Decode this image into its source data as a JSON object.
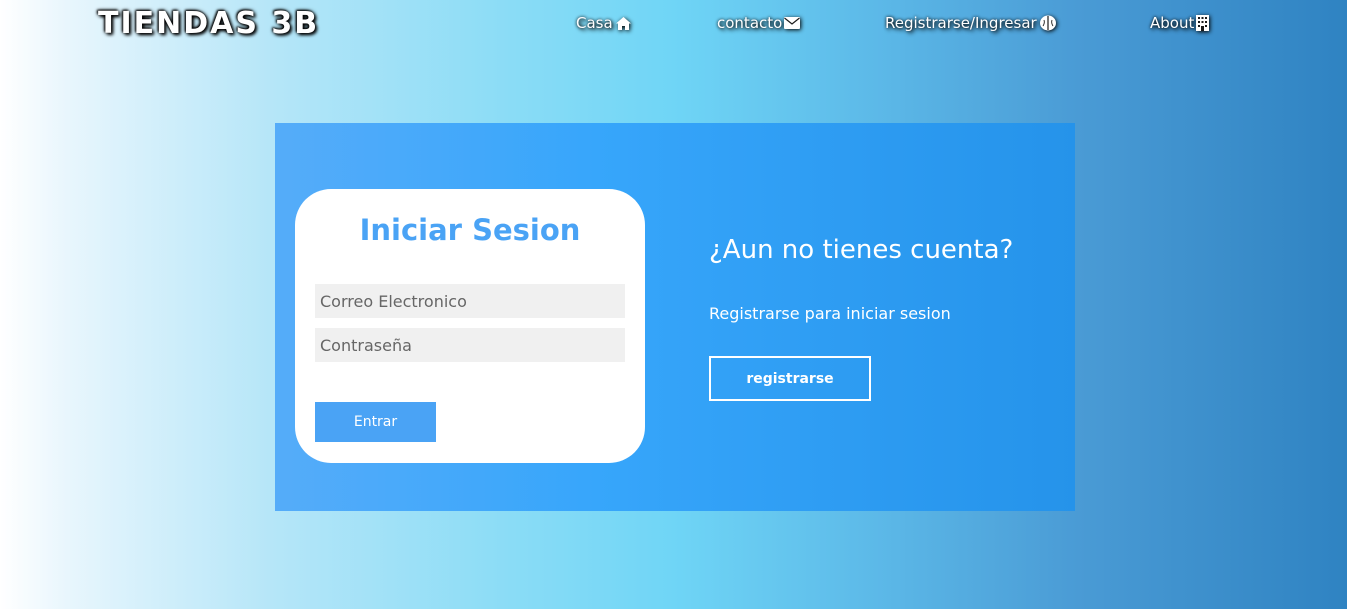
{
  "header": {
    "logo": "TIENDAS 3B",
    "nav": [
      {
        "label": "Casa",
        "icon": "home-icon"
      },
      {
        "label": "contacto",
        "icon": "envelope-icon"
      },
      {
        "label": "Registrarse/Ingresar",
        "icon": "brain-icon"
      },
      {
        "label": "About",
        "icon": "building-icon"
      }
    ]
  },
  "login": {
    "title": "Iniciar Sesion",
    "email_placeholder": "Correo Electronico",
    "password_placeholder": "Contraseña",
    "submit_label": "Entrar"
  },
  "signup": {
    "title": "¿Aun no tienes cuenta?",
    "subtitle": "Registrarse para iniciar sesion",
    "button_label": "registrarse"
  },
  "colors": {
    "panel": "#37a6fb",
    "accent": "#4aa3f5",
    "card": "#ffffff"
  }
}
